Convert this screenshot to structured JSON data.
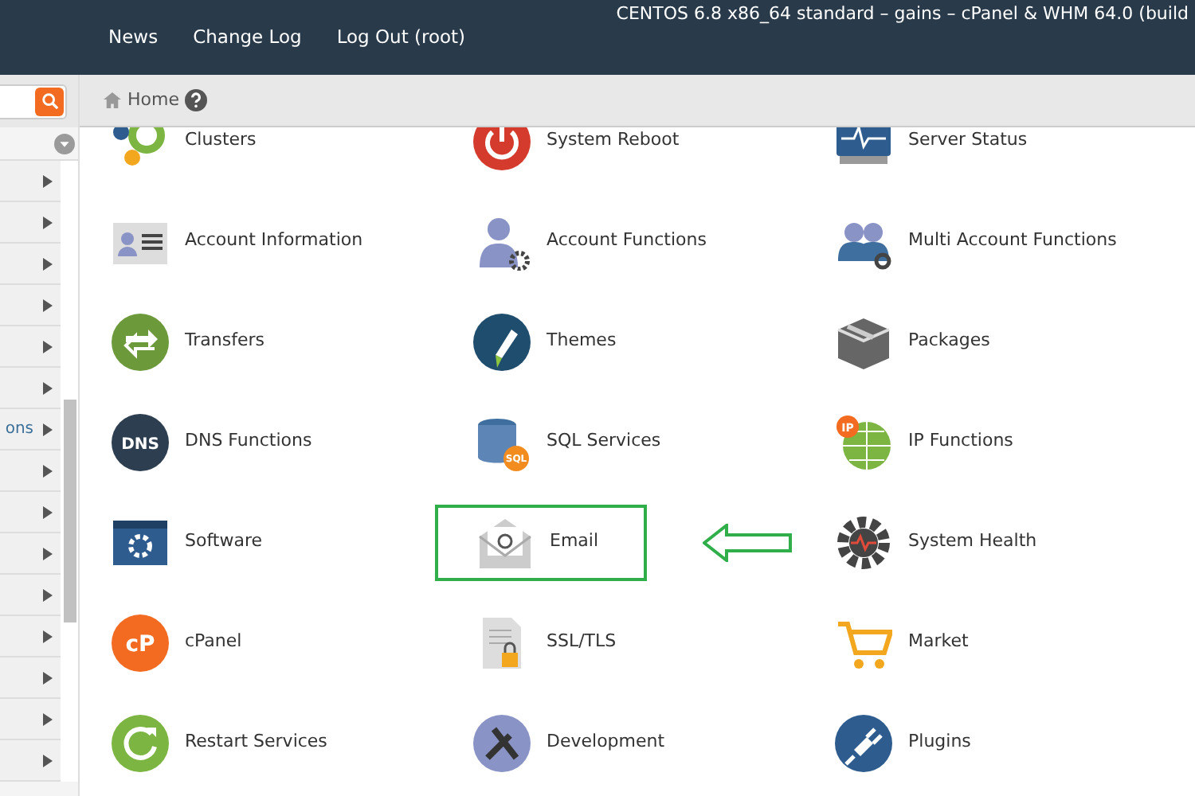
{
  "header": {
    "system_info": "CENTOS 6.8 x86_64 standard – gains – cPanel & WHM 64.0 (build",
    "links": [
      "News",
      "Change Log",
      "Log Out (root)"
    ]
  },
  "sidebar": {
    "items": [
      {
        "expanded": false
      },
      {
        "expanded": false
      },
      {
        "expanded": false
      },
      {
        "expanded": false
      },
      {
        "expanded": false
      },
      {
        "expanded": false
      },
      {
        "label": "ons",
        "expanded": false
      },
      {
        "expanded": false
      },
      {
        "expanded": false
      },
      {
        "expanded": false
      },
      {
        "expanded": false
      },
      {
        "expanded": false
      },
      {
        "expanded": false
      },
      {
        "expanded": false
      },
      {
        "expanded": false
      }
    ]
  },
  "breadcrumb": {
    "label": "Home"
  },
  "features": [
    {
      "label": "Clusters",
      "highlighted": false
    },
    {
      "label": "System Reboot",
      "highlighted": false
    },
    {
      "label": "Server Status",
      "highlighted": false
    },
    {
      "label": "Account Information",
      "highlighted": false
    },
    {
      "label": "Account Functions",
      "highlighted": false
    },
    {
      "label": "Multi Account Functions",
      "highlighted": false
    },
    {
      "label": "Transfers",
      "highlighted": false
    },
    {
      "label": "Themes",
      "highlighted": false
    },
    {
      "label": "Packages",
      "highlighted": false
    },
    {
      "label": "DNS Functions",
      "highlighted": false,
      "icon_text": "DNS"
    },
    {
      "label": "SQL Services",
      "highlighted": false,
      "icon_text": "SQL"
    },
    {
      "label": "IP Functions",
      "highlighted": false,
      "icon_text": "IP"
    },
    {
      "label": "Software",
      "highlighted": false
    },
    {
      "label": "Email",
      "highlighted": true
    },
    {
      "label": "System Health",
      "highlighted": false
    },
    {
      "label": "cPanel",
      "highlighted": false,
      "icon_text": "cP"
    },
    {
      "label": "SSL/TLS",
      "highlighted": false
    },
    {
      "label": "Market",
      "highlighted": false
    },
    {
      "label": "Restart Services",
      "highlighted": false
    },
    {
      "label": "Development",
      "highlighted": false
    },
    {
      "label": "Plugins",
      "highlighted": false
    }
  ]
}
